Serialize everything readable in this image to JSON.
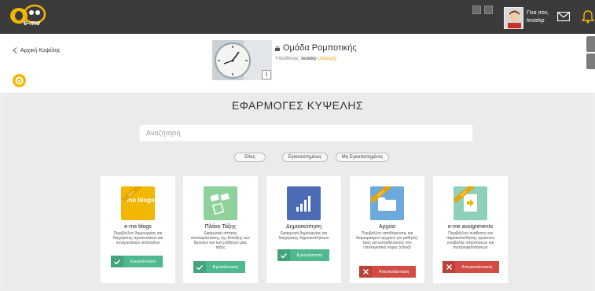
{
  "app": {
    "logo_text": "e-me"
  },
  "user": {
    "greeting": "Γεια σου,",
    "username": "testekp"
  },
  "header": {
    "back_label": "Αρχική Κυψέλης",
    "group_name": "Ομάδα Ρομποτικής",
    "owner_prefix": "Υπεύθυνος:",
    "owner": "testekp",
    "change_label": "(Αλλαγή)",
    "info_label": "i"
  },
  "main": {
    "title": "ΕΦΑΡΜΟΓΕΣ ΚΥΨΕΛΗΣ",
    "search_placeholder": "Αναζήτηση",
    "filters": [
      {
        "label": "Όλες"
      },
      {
        "label": "Εγκατεστημένες"
      },
      {
        "label": "Μη Εγκατεστημένες"
      }
    ]
  },
  "cards": [
    {
      "name": "e-me blogs",
      "description": "Περιβάλλον δημιουργίας και διαχείρισης προσωπικών και συνεργατικών ιστολογίων",
      "action": "Εγκατάσταση",
      "icon_text": "e-me blogs",
      "ribbon": "default"
    },
    {
      "name": "Πλάνο Τάξης",
      "description": "Εφαρμογή οπτικής αναπαράστασης της διάταξης των θρανίων και των μαθητών μιας τάξης",
      "action": "Εγκατάσταση"
    },
    {
      "name": "Δημοσκόπηση",
      "description": "Εφαρμογή δημιουργίας και διαχείρισης δημοσκοπήσεων",
      "action": "Εγκατάσταση"
    },
    {
      "name": "Αρχεία",
      "description": "Περιβάλλον αποθήκευσης και διαμοιρασμού αρχείων για μαθητές/τριες και εκπαιδευτικούς στο υπολογιστικό νέφος (cloud)",
      "action": "Απεγκατάσταση",
      "ribbon": "default"
    },
    {
      "name": "e-me assignments",
      "description": "Περιβάλλον ανάθεσης και παρακολούθησης εργασιών υποβολής απαντήσεων και ανατροφοδοτήσεων",
      "action": "Απεγκατάσταση",
      "ribbon": "default"
    }
  ]
}
